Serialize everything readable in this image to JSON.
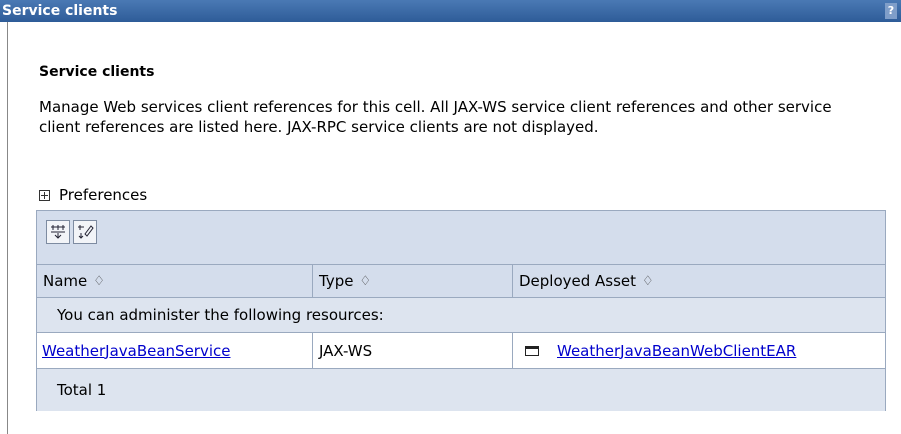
{
  "window": {
    "title": "Service clients",
    "help_icon": "?"
  },
  "page": {
    "heading": "Service clients",
    "description": "Manage Web services client references for this cell. All JAX-WS service client references and other service client references are listed here. JAX-RPC service clients are not displayed.",
    "preferences_label": "Preferences"
  },
  "toolbar": {
    "icons": [
      "filter-table-icon",
      "edit-filter-icon"
    ]
  },
  "table": {
    "columns": [
      "Name",
      "Type",
      "Deployed Asset"
    ],
    "sort_glyph": "♢",
    "info_message": "You can administer the following resources:",
    "rows": [
      {
        "name": "WeatherJavaBeanService",
        "type": "JAX-WS",
        "deployed_asset": "WeatherJavaBeanWebClientEAR"
      }
    ],
    "total": "Total 1"
  }
}
